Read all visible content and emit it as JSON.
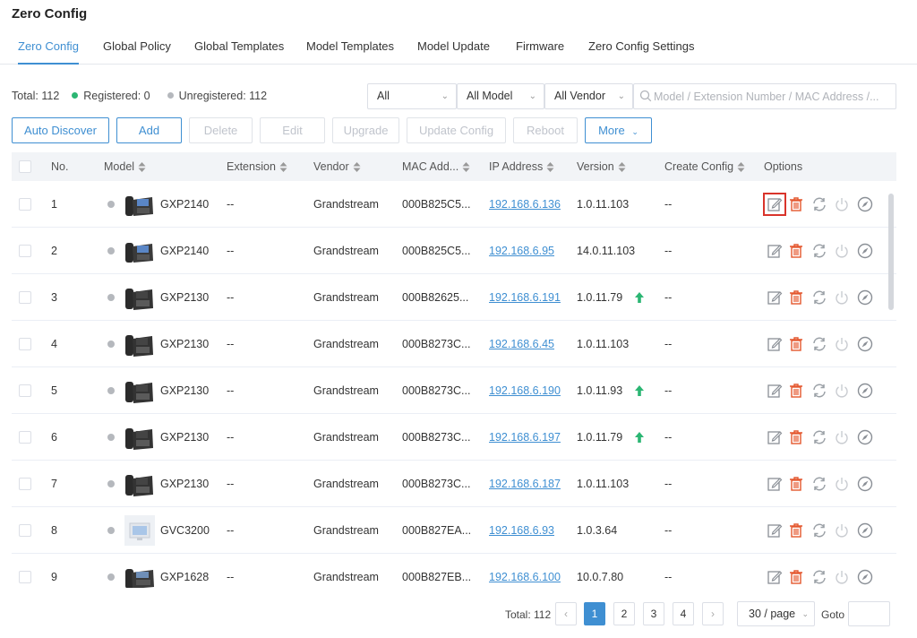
{
  "page": {
    "title": "Zero Config"
  },
  "tabs": [
    {
      "label": "Zero Config",
      "active": true
    },
    {
      "label": "Global Policy"
    },
    {
      "label": "Global Templates"
    },
    {
      "label": "Model Templates"
    },
    {
      "label": "Model Update"
    },
    {
      "label": "Firmware"
    },
    {
      "label": "Zero Config Settings"
    }
  ],
  "stats": {
    "total": "Total: 112",
    "registered": "Registered: 0",
    "unregistered": "Unregistered: 112",
    "registered_color": "#2bb673",
    "unregistered_color": "#b5b8bd"
  },
  "filters": {
    "status": "All",
    "model": "All Model",
    "vendor": "All Vendor",
    "search_placeholder": "Model / Extension Number / MAC Address /..."
  },
  "toolbar": {
    "auto_discover": "Auto Discover",
    "add": "Add",
    "delete": "Delete",
    "edit": "Edit",
    "upgrade": "Upgrade",
    "update_config": "Update Config",
    "reboot": "Reboot",
    "more": "More"
  },
  "table": {
    "headers": {
      "no": "No.",
      "model": "Model",
      "extension": "Extension",
      "vendor": "Vendor",
      "mac": "MAC Add...",
      "ip": "IP Address",
      "version": "Version",
      "create_config": "Create Config",
      "options": "Options"
    },
    "rows": [
      {
        "no": "1",
        "model": "GXP2140",
        "device": "gxp2140",
        "extension": "--",
        "vendor": "Grandstream",
        "mac": "000B825C5...",
        "ip": "192.168.6.136",
        "version": "1.0.11.103",
        "upgrade": false,
        "create_config": "--",
        "edit_highlight": true
      },
      {
        "no": "2",
        "model": "GXP2140",
        "device": "gxp2140",
        "extension": "--",
        "vendor": "Grandstream",
        "mac": "000B825C5...",
        "ip": "192.168.6.95",
        "version": "14.0.11.103",
        "upgrade": false,
        "create_config": "--"
      },
      {
        "no": "3",
        "model": "GXP2130",
        "device": "gxp2130",
        "extension": "--",
        "vendor": "Grandstream",
        "mac": "000B82625...",
        "ip": "192.168.6.191",
        "version": "1.0.11.79",
        "upgrade": true,
        "create_config": "--"
      },
      {
        "no": "4",
        "model": "GXP2130",
        "device": "gxp2130",
        "extension": "--",
        "vendor": "Grandstream",
        "mac": "000B8273C...",
        "ip": "192.168.6.45",
        "version": "1.0.11.103",
        "upgrade": false,
        "create_config": "--"
      },
      {
        "no": "5",
        "model": "GXP2130",
        "device": "gxp2130",
        "extension": "--",
        "vendor": "Grandstream",
        "mac": "000B8273C...",
        "ip": "192.168.6.190",
        "version": "1.0.11.93",
        "upgrade": true,
        "create_config": "--"
      },
      {
        "no": "6",
        "model": "GXP2130",
        "device": "gxp2130",
        "extension": "--",
        "vendor": "Grandstream",
        "mac": "000B8273C...",
        "ip": "192.168.6.197",
        "version": "1.0.11.79",
        "upgrade": true,
        "create_config": "--"
      },
      {
        "no": "7",
        "model": "GXP2130",
        "device": "gxp2130",
        "extension": "--",
        "vendor": "Grandstream",
        "mac": "000B8273C...",
        "ip": "192.168.6.187",
        "version": "1.0.11.103",
        "upgrade": false,
        "create_config": "--"
      },
      {
        "no": "8",
        "model": "GVC3200",
        "device": "gvc3200",
        "extension": "--",
        "vendor": "Grandstream",
        "mac": "000B827EA...",
        "ip": "192.168.6.93",
        "version": "1.0.3.64",
        "upgrade": false,
        "create_config": "--"
      },
      {
        "no": "9",
        "model": "GXP1628",
        "device": "gxp1628",
        "extension": "--",
        "vendor": "Grandstream",
        "mac": "000B827EB...",
        "ip": "192.168.6.100",
        "version": "10.0.7.80",
        "upgrade": false,
        "create_config": "--"
      }
    ]
  },
  "pagination": {
    "total": "Total: 112",
    "prev": "‹",
    "next": "›",
    "pages": [
      "1",
      "2",
      "3",
      "4"
    ],
    "current": "1",
    "page_size": "30 / page",
    "goto_label": "Goto"
  },
  "colors": {
    "accent": "#3f8fd2",
    "delete_red": "#e4572e",
    "highlight_red": "#d9342b",
    "upgrade_green": "#2bb673",
    "status_grey": "#b5b8bd"
  },
  "icons": {
    "row_options": [
      "edit-icon",
      "delete-icon",
      "refresh-icon",
      "power-icon",
      "compass-icon"
    ],
    "upgrade": "arrow-up-icon",
    "search": "search-icon",
    "dropdown": "chevron-down-icon",
    "sort": "sort-icon"
  }
}
